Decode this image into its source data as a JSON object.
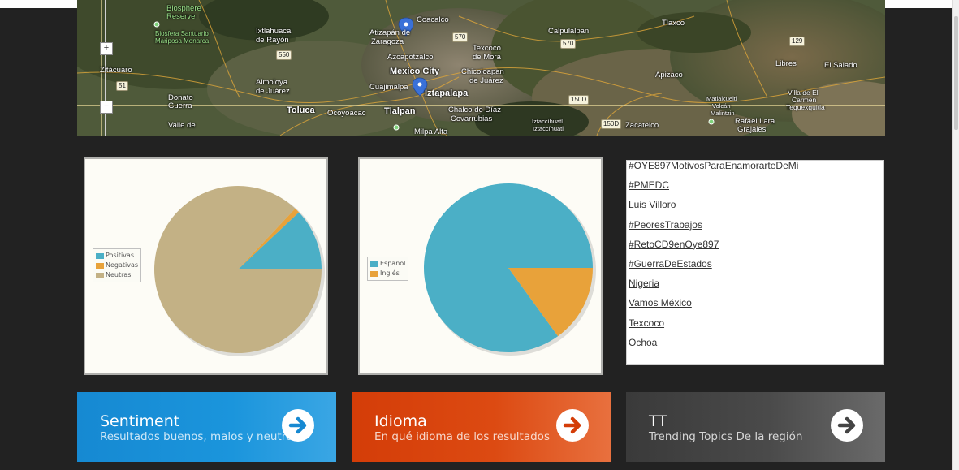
{
  "map": {
    "labels": [
      "Biosphere",
      "Reserve",
      "Biosfera Santuario",
      "Mariposa Monarca",
      "Ixtlahuaca",
      "de Rayón",
      "Atizapán de",
      "Zaragoza",
      "Azcapotzalco",
      "Coacalco",
      "Texcoco",
      "de Mora",
      "Calpulalpan",
      "Tlaxco",
      "Mexico City",
      "Chicoloapan",
      "de Juárez",
      "Zitácuaro",
      "Almoloya",
      "de Juárez",
      "Cuajimalpa",
      "Iztapalapa",
      "Apizaco",
      "Libres",
      "El Salado",
      "Villa de El",
      "Carmen",
      "Tequexquitla",
      "Donato",
      "Guerra",
      "Toluca",
      "Ocoyoacac",
      "Tlalpan",
      "Chalco de Díaz",
      "Covarrubias",
      "Iztaccíhuatl",
      "Iztaccíhuatl",
      "Matlalcueitl",
      "Volcán",
      "Malintzin",
      "Rafael Lara",
      "Grajales",
      "Zacatelco",
      "Valle de",
      "Milpa Alta"
    ],
    "shields": [
      "550",
      "570",
      "570",
      "51",
      "150D",
      "150D",
      "129"
    ],
    "zoom_in": "+",
    "zoom_out": "−"
  },
  "sentiment_chart": {
    "chart_data": {
      "type": "pie",
      "categories": [
        "Positivas",
        "Negativas",
        "Neutras"
      ],
      "values": [
        12,
        1,
        87
      ],
      "colors": [
        "#4bafc6",
        "#e8a23a",
        "#c3b185"
      ],
      "legend": "left"
    }
  },
  "language_chart": {
    "chart_data": {
      "type": "pie",
      "categories": [
        "Español",
        "Inglés"
      ],
      "values": [
        85,
        15
      ],
      "colors": [
        "#4bafc6",
        "#e8a23a"
      ],
      "legend": "left"
    }
  },
  "trending_topics": [
    "#OYE897MotivosParaEnamorarteDeMi",
    "#PMEDC",
    "Luis Villoro",
    "#PeoresTrabajos",
    "#RetoCD9enOye897",
    "#GuerraDeEstados",
    "Nigeria",
    "Vamos México",
    "Texcoco",
    "Ochoa"
  ],
  "tiles": [
    {
      "title": "Sentiment",
      "subtitle": "Resultados buenos, malos y neutros",
      "color": "#1a8fd6",
      "icon": "arrow-right-icon"
    },
    {
      "title": "Idioma",
      "subtitle": "En qué idioma de los resultados",
      "color": "#d9410c",
      "icon": "arrow-right-icon"
    },
    {
      "title": "TT",
      "subtitle": "Trending Topics De la región",
      "color": "#4a4a4a",
      "icon": "arrow-right-icon"
    }
  ]
}
